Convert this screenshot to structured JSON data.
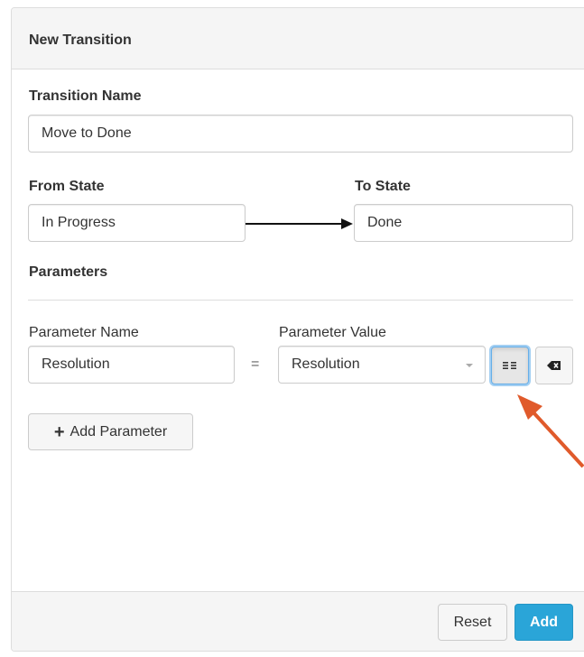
{
  "panel": {
    "title": "New Transition"
  },
  "transition_name": {
    "label": "Transition Name",
    "value": "Move to Done"
  },
  "from_state": {
    "label": "From State",
    "value": "In Progress"
  },
  "to_state": {
    "label": "To State",
    "value": "Done"
  },
  "parameters": {
    "heading": "Parameters",
    "name_label": "Parameter Name",
    "value_label": "Parameter Value",
    "equals": "=",
    "rows": [
      {
        "name": "Resolution",
        "value": "Resolution"
      }
    ],
    "add_label": "Add Parameter",
    "add_icon": "+"
  },
  "footer": {
    "reset_label": "Reset",
    "add_label": "Add"
  },
  "icons": {
    "list_toggle": "list-toggle-icon",
    "clear": "backspace-icon",
    "annotation_arrow_color": "#e05a2b"
  },
  "colors": {
    "primary": "#2aa5d8",
    "focus": "#66afe9"
  }
}
